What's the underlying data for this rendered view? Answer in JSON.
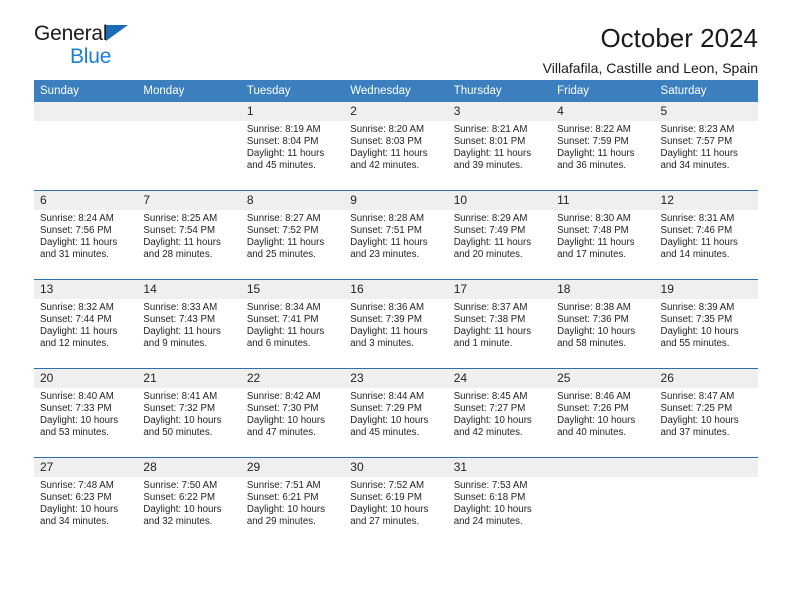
{
  "brand": {
    "name_top": "General",
    "name_bottom": "Blue",
    "accent_color": "#1b7fd4",
    "triangle_color": "#1b6cb5"
  },
  "header": {
    "title": "October 2024",
    "subtitle": "Villafafila, Castille and Leon, Spain"
  },
  "calendar": {
    "header_bg": "#3b7fbe",
    "daynum_bg": "#efefef",
    "row_separator": "#2f6fb0",
    "weekday_headers": [
      "Sunday",
      "Monday",
      "Tuesday",
      "Wednesday",
      "Thursday",
      "Friday",
      "Saturday"
    ],
    "weeks": [
      [
        {
          "day": ""
        },
        {
          "day": ""
        },
        {
          "day": "1",
          "sunrise": "Sunrise: 8:19 AM",
          "sunset": "Sunset: 8:04 PM",
          "daylight": "Daylight: 11 hours and 45 minutes."
        },
        {
          "day": "2",
          "sunrise": "Sunrise: 8:20 AM",
          "sunset": "Sunset: 8:03 PM",
          "daylight": "Daylight: 11 hours and 42 minutes."
        },
        {
          "day": "3",
          "sunrise": "Sunrise: 8:21 AM",
          "sunset": "Sunset: 8:01 PM",
          "daylight": "Daylight: 11 hours and 39 minutes."
        },
        {
          "day": "4",
          "sunrise": "Sunrise: 8:22 AM",
          "sunset": "Sunset: 7:59 PM",
          "daylight": "Daylight: 11 hours and 36 minutes."
        },
        {
          "day": "5",
          "sunrise": "Sunrise: 8:23 AM",
          "sunset": "Sunset: 7:57 PM",
          "daylight": "Daylight: 11 hours and 34 minutes."
        }
      ],
      [
        {
          "day": "6",
          "sunrise": "Sunrise: 8:24 AM",
          "sunset": "Sunset: 7:56 PM",
          "daylight": "Daylight: 11 hours and 31 minutes."
        },
        {
          "day": "7",
          "sunrise": "Sunrise: 8:25 AM",
          "sunset": "Sunset: 7:54 PM",
          "daylight": "Daylight: 11 hours and 28 minutes."
        },
        {
          "day": "8",
          "sunrise": "Sunrise: 8:27 AM",
          "sunset": "Sunset: 7:52 PM",
          "daylight": "Daylight: 11 hours and 25 minutes."
        },
        {
          "day": "9",
          "sunrise": "Sunrise: 8:28 AM",
          "sunset": "Sunset: 7:51 PM",
          "daylight": "Daylight: 11 hours and 23 minutes."
        },
        {
          "day": "10",
          "sunrise": "Sunrise: 8:29 AM",
          "sunset": "Sunset: 7:49 PM",
          "daylight": "Daylight: 11 hours and 20 minutes."
        },
        {
          "day": "11",
          "sunrise": "Sunrise: 8:30 AM",
          "sunset": "Sunset: 7:48 PM",
          "daylight": "Daylight: 11 hours and 17 minutes."
        },
        {
          "day": "12",
          "sunrise": "Sunrise: 8:31 AM",
          "sunset": "Sunset: 7:46 PM",
          "daylight": "Daylight: 11 hours and 14 minutes."
        }
      ],
      [
        {
          "day": "13",
          "sunrise": "Sunrise: 8:32 AM",
          "sunset": "Sunset: 7:44 PM",
          "daylight": "Daylight: 11 hours and 12 minutes."
        },
        {
          "day": "14",
          "sunrise": "Sunrise: 8:33 AM",
          "sunset": "Sunset: 7:43 PM",
          "daylight": "Daylight: 11 hours and 9 minutes."
        },
        {
          "day": "15",
          "sunrise": "Sunrise: 8:34 AM",
          "sunset": "Sunset: 7:41 PM",
          "daylight": "Daylight: 11 hours and 6 minutes."
        },
        {
          "day": "16",
          "sunrise": "Sunrise: 8:36 AM",
          "sunset": "Sunset: 7:39 PM",
          "daylight": "Daylight: 11 hours and 3 minutes."
        },
        {
          "day": "17",
          "sunrise": "Sunrise: 8:37 AM",
          "sunset": "Sunset: 7:38 PM",
          "daylight": "Daylight: 11 hours and 1 minute."
        },
        {
          "day": "18",
          "sunrise": "Sunrise: 8:38 AM",
          "sunset": "Sunset: 7:36 PM",
          "daylight": "Daylight: 10 hours and 58 minutes."
        },
        {
          "day": "19",
          "sunrise": "Sunrise: 8:39 AM",
          "sunset": "Sunset: 7:35 PM",
          "daylight": "Daylight: 10 hours and 55 minutes."
        }
      ],
      [
        {
          "day": "20",
          "sunrise": "Sunrise: 8:40 AM",
          "sunset": "Sunset: 7:33 PM",
          "daylight": "Daylight: 10 hours and 53 minutes."
        },
        {
          "day": "21",
          "sunrise": "Sunrise: 8:41 AM",
          "sunset": "Sunset: 7:32 PM",
          "daylight": "Daylight: 10 hours and 50 minutes."
        },
        {
          "day": "22",
          "sunrise": "Sunrise: 8:42 AM",
          "sunset": "Sunset: 7:30 PM",
          "daylight": "Daylight: 10 hours and 47 minutes."
        },
        {
          "day": "23",
          "sunrise": "Sunrise: 8:44 AM",
          "sunset": "Sunset: 7:29 PM",
          "daylight": "Daylight: 10 hours and 45 minutes."
        },
        {
          "day": "24",
          "sunrise": "Sunrise: 8:45 AM",
          "sunset": "Sunset: 7:27 PM",
          "daylight": "Daylight: 10 hours and 42 minutes."
        },
        {
          "day": "25",
          "sunrise": "Sunrise: 8:46 AM",
          "sunset": "Sunset: 7:26 PM",
          "daylight": "Daylight: 10 hours and 40 minutes."
        },
        {
          "day": "26",
          "sunrise": "Sunrise: 8:47 AM",
          "sunset": "Sunset: 7:25 PM",
          "daylight": "Daylight: 10 hours and 37 minutes."
        }
      ],
      [
        {
          "day": "27",
          "sunrise": "Sunrise: 7:48 AM",
          "sunset": "Sunset: 6:23 PM",
          "daylight": "Daylight: 10 hours and 34 minutes."
        },
        {
          "day": "28",
          "sunrise": "Sunrise: 7:50 AM",
          "sunset": "Sunset: 6:22 PM",
          "daylight": "Daylight: 10 hours and 32 minutes."
        },
        {
          "day": "29",
          "sunrise": "Sunrise: 7:51 AM",
          "sunset": "Sunset: 6:21 PM",
          "daylight": "Daylight: 10 hours and 29 minutes."
        },
        {
          "day": "30",
          "sunrise": "Sunrise: 7:52 AM",
          "sunset": "Sunset: 6:19 PM",
          "daylight": "Daylight: 10 hours and 27 minutes."
        },
        {
          "day": "31",
          "sunrise": "Sunrise: 7:53 AM",
          "sunset": "Sunset: 6:18 PM",
          "daylight": "Daylight: 10 hours and 24 minutes."
        },
        {
          "day": ""
        },
        {
          "day": ""
        }
      ]
    ]
  }
}
